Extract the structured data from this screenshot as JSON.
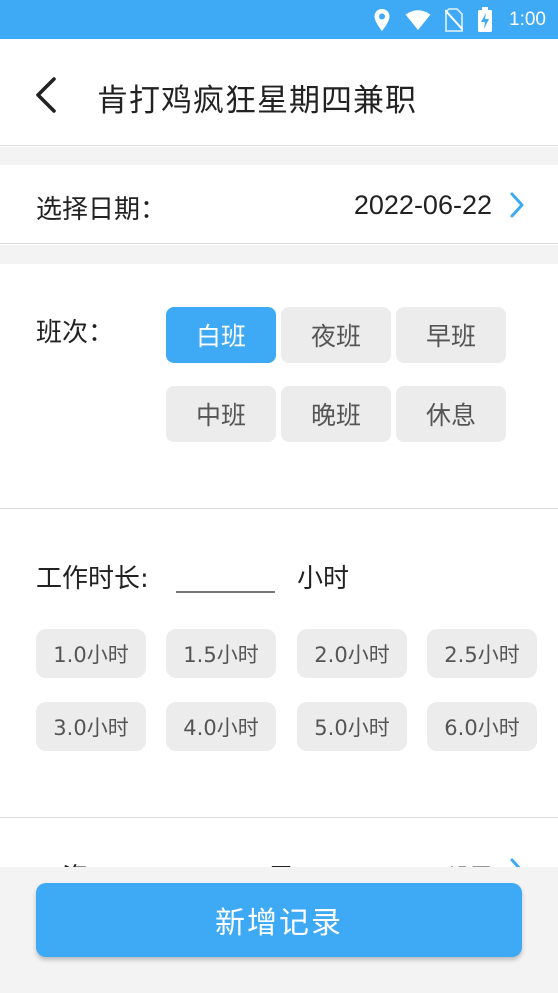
{
  "status_bar": {
    "time": "1:00",
    "icons": [
      "location-icon",
      "wifi-icon",
      "no-sim-icon",
      "battery-charging-icon"
    ],
    "color": "#3ea9f5"
  },
  "header": {
    "title": "肯打鸡疯狂星期四兼职",
    "back_icon": "chevron-left-icon"
  },
  "date": {
    "label": "选择日期：",
    "value": "2022-06-22",
    "chevron_icon": "chevron-right-icon"
  },
  "shift": {
    "label": "班次：",
    "options": [
      "白班",
      "夜班",
      "早班",
      "中班",
      "晚班",
      "休息"
    ],
    "selected": "白班"
  },
  "work_hours": {
    "label": "工作时长:",
    "value": "",
    "unit": "小时",
    "presets": [
      "1.0小时",
      "1.5小时",
      "2.0小时",
      "2.5小时",
      "3.0小时",
      "4.0小时",
      "5.0小时",
      "6.0小时"
    ]
  },
  "salary": {
    "label": "工资",
    "unit": "元",
    "action": "设置"
  },
  "add_button": {
    "label": "新增记录"
  },
  "colors": {
    "accent": "#3ea9f5",
    "chip_bg": "#ececec",
    "section_gap": "#f3f3f3"
  }
}
